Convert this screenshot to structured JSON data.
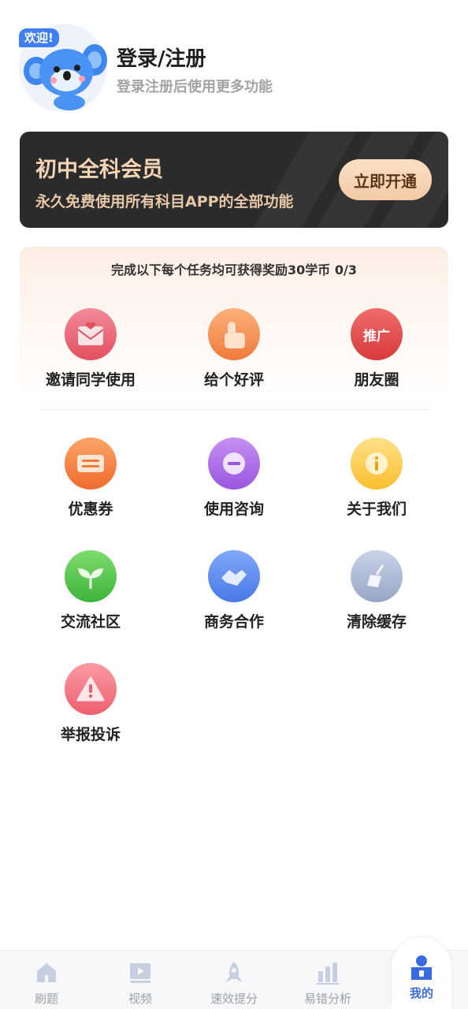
{
  "header": {
    "badge": "欢迎!",
    "title": "登录/注册",
    "subtitle": "登录注册后使用更多功能"
  },
  "member": {
    "title": "初中全科会员",
    "subtitle": "永久免费使用所有科目APP的全部功能",
    "button": "立即开通"
  },
  "tasks": {
    "heading": "完成以下每个任务均可获得奖励30学币 0/3",
    "items": [
      {
        "label": "邀请同学使用",
        "icon": "invite-icon"
      },
      {
        "label": "给个好评",
        "icon": "thumbs-up-icon"
      },
      {
        "label": "朋友圈",
        "icon": "promote-icon",
        "badge": "推广"
      }
    ]
  },
  "features": [
    {
      "label": "优惠券",
      "icon": "coupon-icon"
    },
    {
      "label": "使用咨询",
      "icon": "chat-icon"
    },
    {
      "label": "关于我们",
      "icon": "info-icon"
    },
    {
      "label": "交流社区",
      "icon": "sprout-icon"
    },
    {
      "label": "商务合作",
      "icon": "handshake-icon"
    },
    {
      "label": "清除缓存",
      "icon": "broom-icon"
    },
    {
      "label": "举报投诉",
      "icon": "warning-icon"
    }
  ],
  "nav": {
    "items": [
      {
        "label": "刷题",
        "icon": "home-icon"
      },
      {
        "label": "视频",
        "icon": "video-icon"
      },
      {
        "label": "速效提分",
        "icon": "rocket-icon"
      },
      {
        "label": "易错分析",
        "icon": "bar-chart-icon"
      },
      {
        "label": "我的",
        "icon": "profile-icon"
      }
    ],
    "active": "我的"
  },
  "colors": {
    "accent": "#3a6be0",
    "member_bg": "#2b2b2b",
    "member_text": "#f3d4b5"
  }
}
